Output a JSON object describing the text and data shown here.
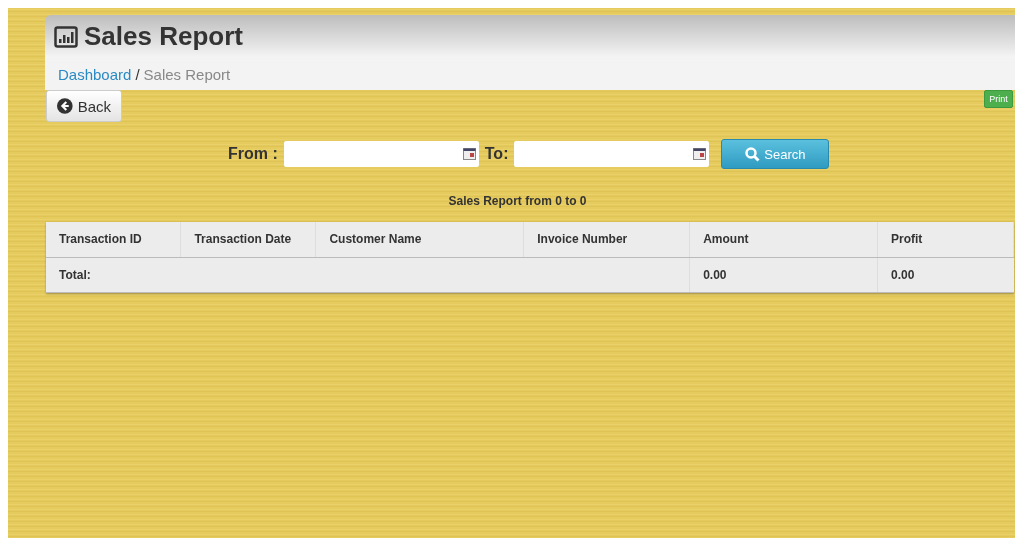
{
  "header": {
    "title": "Sales Report"
  },
  "breadcrumb": {
    "link": "Dashboard",
    "separator": "/",
    "current": "Sales Report"
  },
  "back_button": "Back",
  "print_button": "Print",
  "filter": {
    "from_label": "From :",
    "to_label": "To:",
    "search_button": "Search"
  },
  "report_caption": "Sales Report from 0 to 0",
  "table": {
    "columns": [
      "Transaction ID",
      "Transaction Date",
      "Customer Name",
      "Invoice Number",
      "Amount",
      "Profit"
    ],
    "total_row": {
      "label": "Total:",
      "amount": "0.00",
      "profit": "0.00"
    }
  }
}
